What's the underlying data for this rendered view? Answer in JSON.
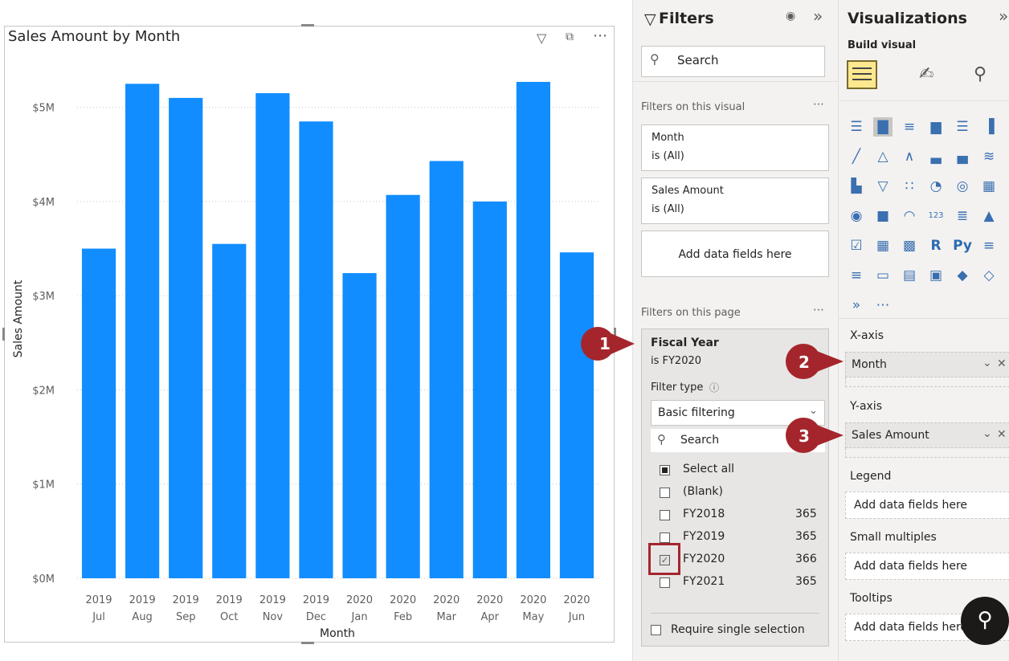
{
  "chart_data": {
    "type": "bar",
    "title": "Sales Amount by Month",
    "xlabel": "Month",
    "ylabel": "Sales Amount",
    "categories": [
      "2019 Jul",
      "2019 Aug",
      "2019 Sep",
      "2019 Oct",
      "2019 Nov",
      "2019 Dec",
      "2020 Jan",
      "2020 Feb",
      "2020 Mar",
      "2020 Apr",
      "2020 May",
      "2020 Jun"
    ],
    "category_lines": [
      [
        "2019",
        "Jul"
      ],
      [
        "2019",
        "Aug"
      ],
      [
        "2019",
        "Sep"
      ],
      [
        "2019",
        "Oct"
      ],
      [
        "2019",
        "Nov"
      ],
      [
        "2019",
        "Dec"
      ],
      [
        "2020",
        "Jan"
      ],
      [
        "2020",
        "Feb"
      ],
      [
        "2020",
        "Mar"
      ],
      [
        "2020",
        "Apr"
      ],
      [
        "2020",
        "May"
      ],
      [
        "2020",
        "Jun"
      ]
    ],
    "values": [
      3.5,
      5.25,
      5.1,
      3.55,
      5.15,
      4.85,
      3.24,
      4.07,
      4.43,
      4.0,
      5.27,
      3.46
    ],
    "unit": "$M",
    "ylim": [
      0,
      5.5
    ],
    "yticks": [
      0,
      1,
      2,
      3,
      4,
      5
    ],
    "ytick_labels": [
      "$0M",
      "$1M",
      "$2M",
      "$3M",
      "$4M",
      "$5M"
    ],
    "grid": true,
    "bar_color": "#118dff"
  },
  "filters": {
    "title": "Filters",
    "search_placeholder": "Search",
    "on_this_visual": "Filters on this visual",
    "visual_cards": [
      {
        "field": "Month",
        "state": "is (All)"
      },
      {
        "field": "Sales Amount",
        "state": "is (All)"
      }
    ],
    "add_fields": "Add data fields here",
    "on_this_page": "Filters on this page",
    "fiscal_year": {
      "field": "Fiscal Year",
      "state": "is FY2020",
      "filter_type_label": "Filter type",
      "filter_type_value": "Basic filtering",
      "search_placeholder": "Search",
      "select_all": "Select all",
      "items": [
        {
          "label": "(Blank)",
          "count": "",
          "checked": false
        },
        {
          "label": "FY2018",
          "count": "365",
          "checked": false
        },
        {
          "label": "FY2019",
          "count": "365",
          "checked": false
        },
        {
          "label": "FY2020",
          "count": "366",
          "checked": true
        },
        {
          "label": "FY2021",
          "count": "365",
          "checked": false
        }
      ],
      "require_single": "Require single selection"
    }
  },
  "viz": {
    "title": "Visualizations",
    "build_visual": "Build visual",
    "x_axis": "X-axis",
    "x_field": "Month",
    "y_axis": "Y-axis",
    "y_field": "Sales Amount",
    "legend": "Legend",
    "legend_drop": "Add data fields here",
    "small_multiples": "Small multiples",
    "small_multiples_drop": "Add data fields here",
    "tooltips": "Tooltips",
    "tooltips_drop": "Add data fields here",
    "icon_py": "Py",
    "icon_r": "R",
    "icon_123": "123"
  },
  "callouts": [
    "1",
    "2",
    "3"
  ],
  "colors": {
    "accent": "#118dff",
    "callout": "#a4262c"
  }
}
